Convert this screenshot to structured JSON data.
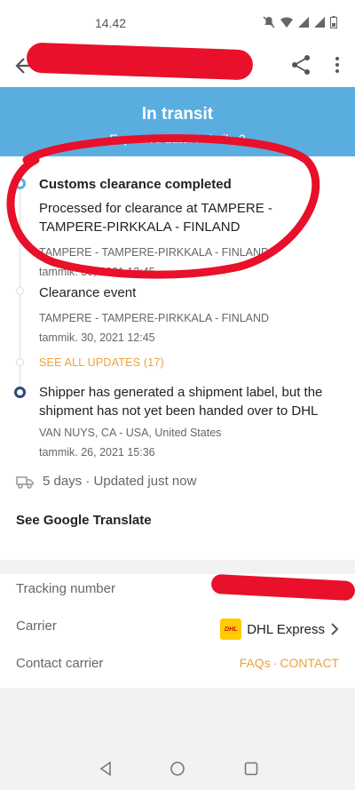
{
  "status_bar": {
    "time": "14.42"
  },
  "banner": {
    "title": "In transit",
    "subtitle": "Expected date: helmik. 2"
  },
  "events": [
    {
      "title": "Customs clearance completed",
      "desc": "Processed for clearance at  TAMPERE - TAMPERE-PIRKKALA - FINLAND",
      "loc": "TAMPERE - TAMPERE-PIRKKALA - FINLAND",
      "ts": "tammik. 30, 2021 12:45"
    },
    {
      "title": "Clearance event",
      "loc": "TAMPERE - TAMPERE-PIRKKALA - FINLAND",
      "ts": "tammik. 30, 2021 12:45"
    },
    {
      "title": "Shipper has generated a shipment label, but the shipment has not yet been handed over to DHL",
      "loc": "VAN NUYS, CA - USA, United States",
      "ts": "tammik. 26, 2021 15:36"
    }
  ],
  "see_all": "SEE ALL UPDATES (17)",
  "eta": "5 days · Updated just now",
  "translate": "See Google Translate",
  "details": {
    "tracking_label": "Tracking number",
    "carrier_label": "Carrier",
    "carrier_value": "DHL Express",
    "carrier_logo_text": "DHL",
    "contact_label": "Contact carrier",
    "faqs": "FAQs",
    "dot": "·",
    "contact": "CONTACT"
  },
  "colors": {
    "banner": "#5aaedf",
    "accent": "#e9a23b",
    "redaction": "#e8102a"
  }
}
